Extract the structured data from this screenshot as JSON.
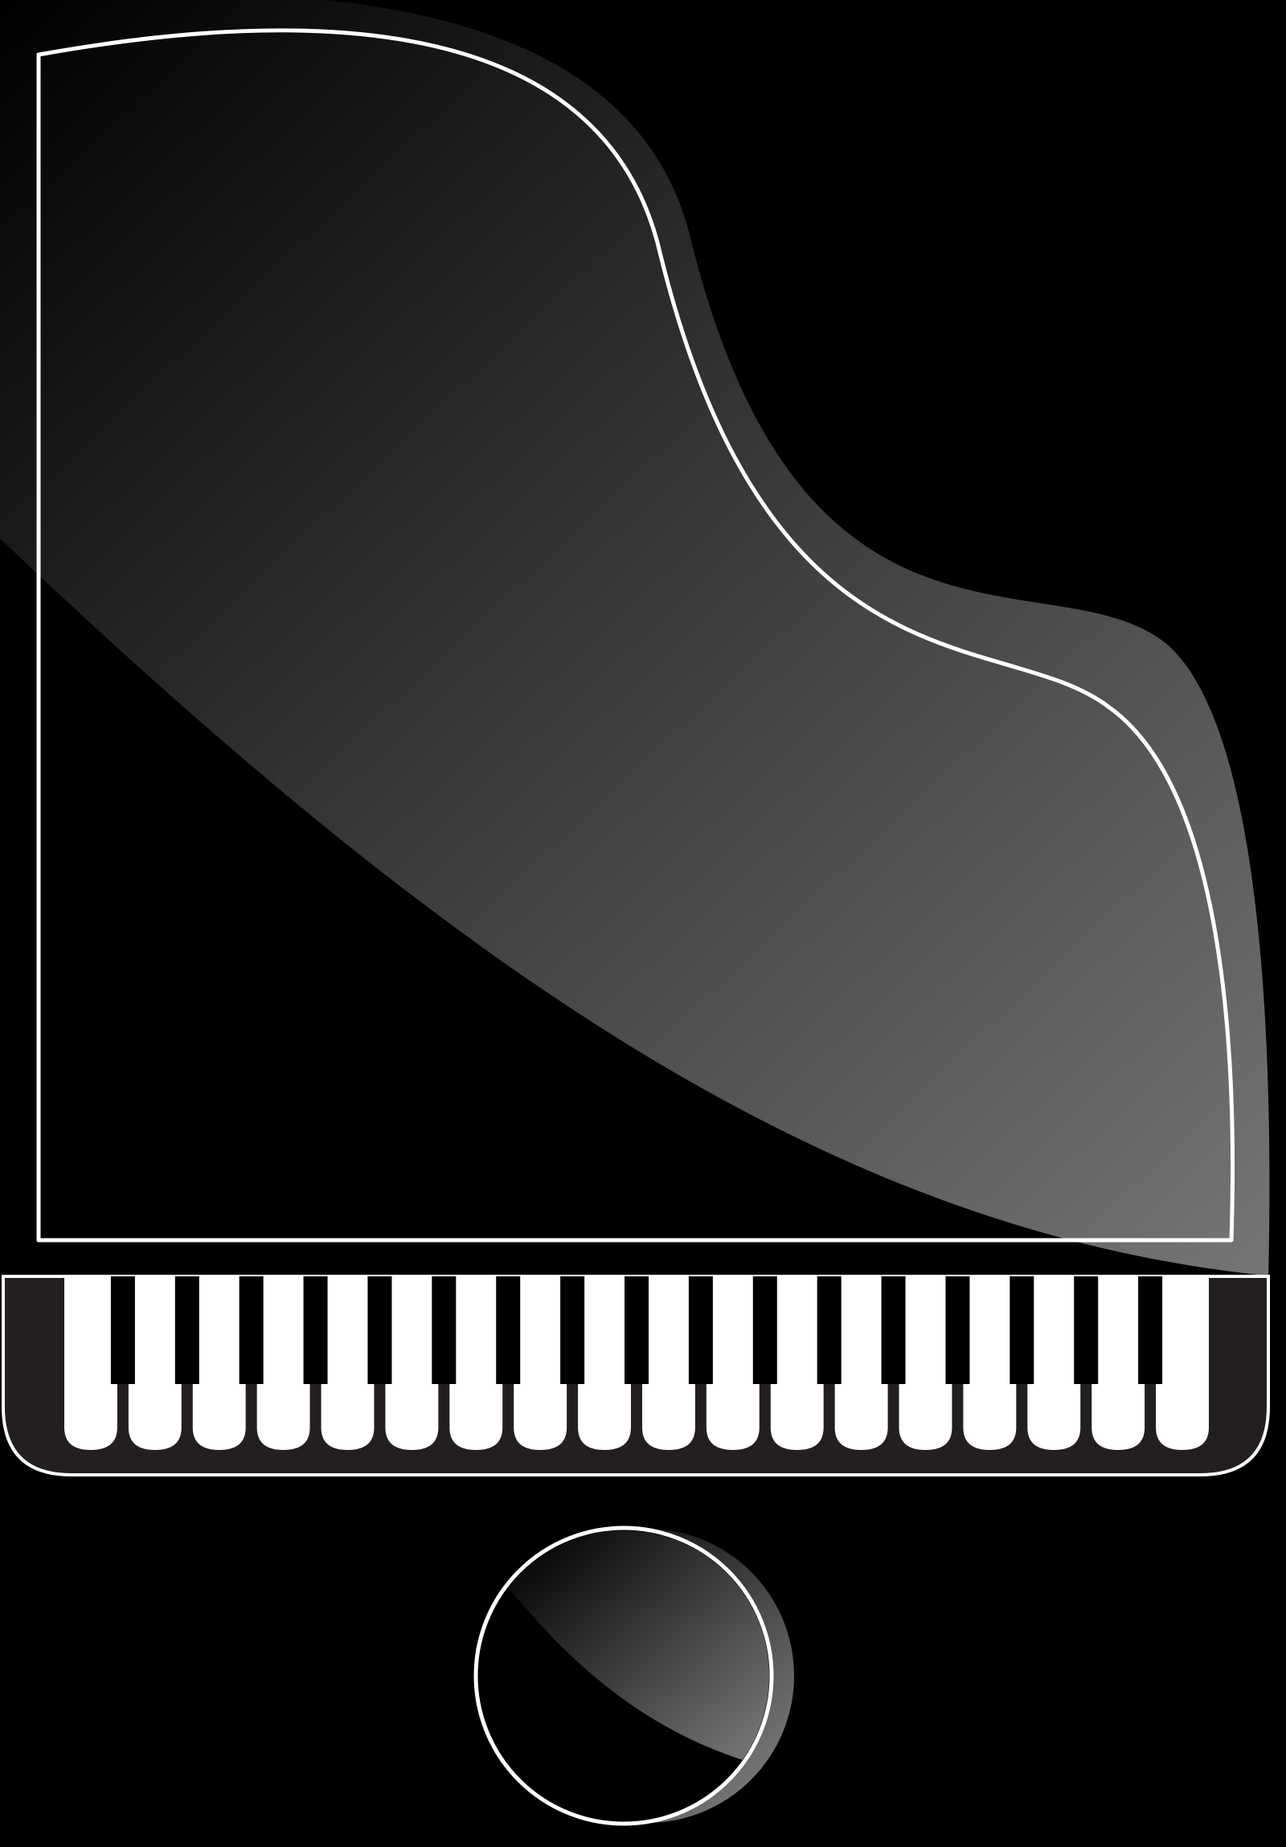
{
  "illustration": {
    "subject": "grand-piano-icon",
    "colors": {
      "background": "#000000",
      "body": "#000000",
      "outline": "#ffffff",
      "highlight_light": "#777777",
      "highlight_dark": "#000000",
      "keybed": "#231f20",
      "white_key": "#ffffff",
      "black_key": "#000000"
    },
    "keyboard": {
      "white_key_count": 18,
      "black_key_count": 17
    },
    "stool": {
      "shape": "circle"
    }
  }
}
